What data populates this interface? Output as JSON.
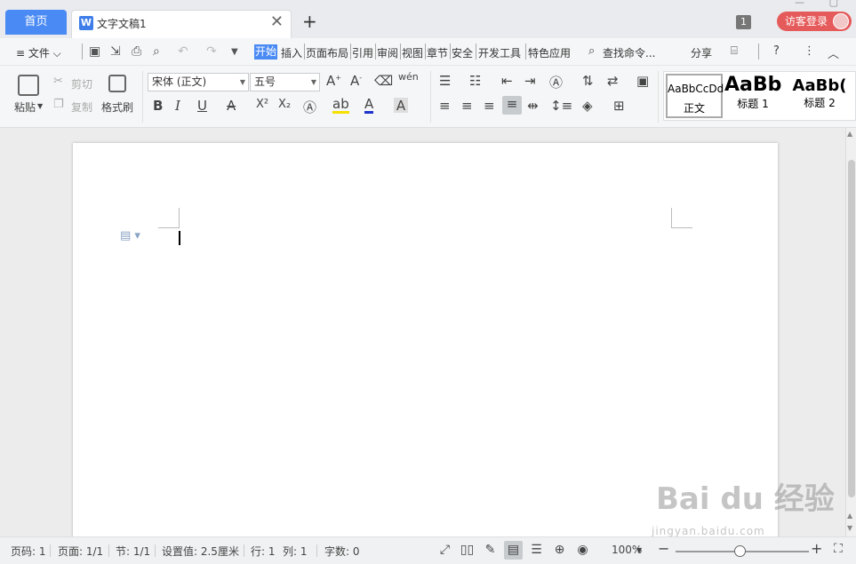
{
  "tabs": {
    "home": "首页",
    "doc_icon": "W",
    "doc_title": "文字文稿1",
    "close": "✕",
    "add": "+"
  },
  "header": {
    "badge": "1",
    "visitor_login": "访客登录"
  },
  "menubar": {
    "file": "≡ 文件 ⌵",
    "items": [
      "开始",
      "插入",
      "页面布局",
      "引用",
      "审阅",
      "视图",
      "章节",
      "安全",
      "开发工具",
      "特色应用"
    ],
    "active_index": 0,
    "search": "查找命令...",
    "share": "分享",
    "help": "?"
  },
  "ribbon": {
    "paste": "粘贴",
    "cut": "剪切",
    "copy": "复制",
    "format_painter": "格式刷",
    "font_name": "宋体 (正文)",
    "font_size": "五号",
    "bold": "B",
    "italic": "I",
    "underline": "U",
    "strike": "A",
    "superscript": "X²",
    "subscript": "X₂",
    "styles": [
      {
        "sample": "AaBbCcDd",
        "name": "正文"
      },
      {
        "sample": "AaBb",
        "name": "标题 1"
      },
      {
        "sample": "AaBb(",
        "name": "标题 2"
      }
    ],
    "accent_color": "#4a8af4"
  },
  "status": {
    "page": "页码: 1",
    "pages": "页面: 1/1",
    "section": "节: 1/1",
    "setting": "设置值: 2.5厘米",
    "row": "行: 1",
    "col": "列: 1",
    "words": "字数: 0",
    "zoom": "100%",
    "zoom_level_percent": 100
  },
  "watermark": {
    "main": "Bai du 经验",
    "sub": "jingyan.baidu.com"
  }
}
